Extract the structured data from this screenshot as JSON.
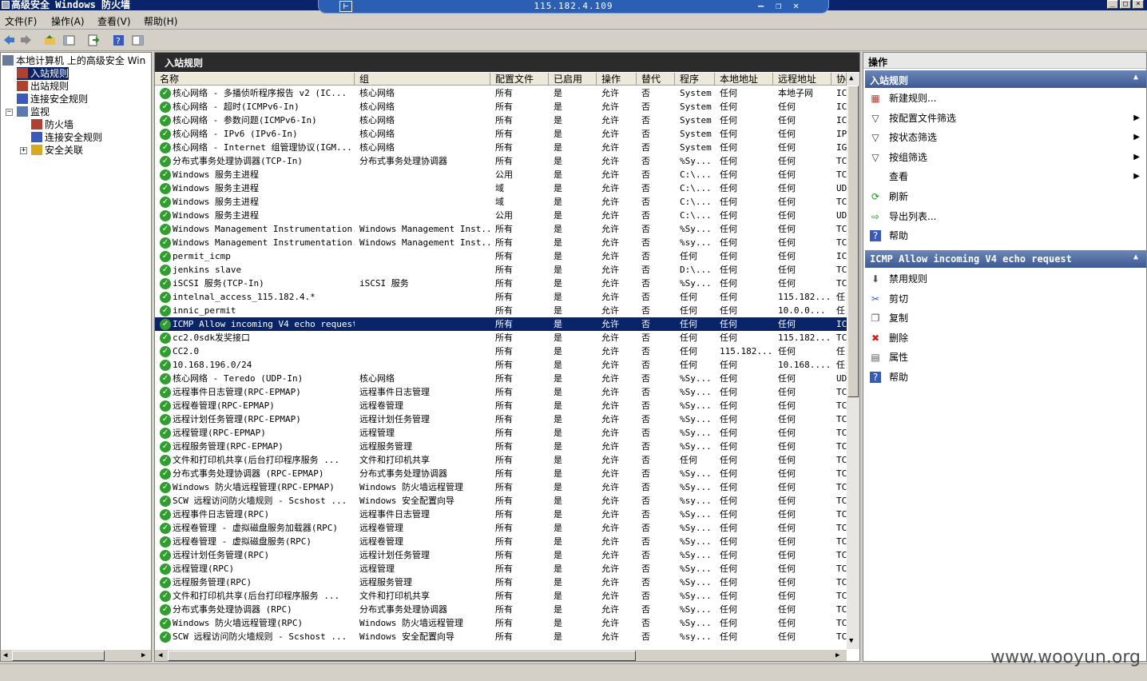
{
  "window": {
    "title": "高级安全 Windows 防火墙",
    "remote_ip": "115.182.4.109"
  },
  "menu": [
    "文件(F)",
    "操作(A)",
    "查看(V)",
    "帮助(H)"
  ],
  "tree": {
    "root": "本地计算机 上的高级安全 Win",
    "items": [
      "入站规则",
      "出站规则",
      "连接安全规则",
      "监视",
      "防火墙",
      "连接安全规则",
      "安全关联"
    ]
  },
  "center": {
    "title": "入站规则",
    "columns": [
      "名称",
      "组",
      "配置文件",
      "已启用",
      "操作",
      "替代",
      "程序",
      "本地地址",
      "远程地址",
      "协"
    ],
    "rows": [
      [
        "核心网络 - 多播侦听程序报告 v2 (IC...",
        "核心网络",
        "所有",
        "是",
        "允许",
        "否",
        "System",
        "任何",
        "本地子网",
        "IC"
      ],
      [
        "核心网络 - 超时(ICMPv6-In)",
        "核心网络",
        "所有",
        "是",
        "允许",
        "否",
        "System",
        "任何",
        "任何",
        "IC"
      ],
      [
        "核心网络 - 参数问题(ICMPv6-In)",
        "核心网络",
        "所有",
        "是",
        "允许",
        "否",
        "System",
        "任何",
        "任何",
        "IC"
      ],
      [
        "核心网络 - IPv6 (IPv6-In)",
        "核心网络",
        "所有",
        "是",
        "允许",
        "否",
        "System",
        "任何",
        "任何",
        "IP"
      ],
      [
        "核心网络 - Internet 组管理协议(IGM...",
        "核心网络",
        "所有",
        "是",
        "允许",
        "否",
        "System",
        "任何",
        "任何",
        "IG"
      ],
      [
        "分布式事务处理协调器(TCP-In)",
        "分布式事务处理协调器",
        "所有",
        "是",
        "允许",
        "否",
        "%Sy...",
        "任何",
        "任何",
        "TC"
      ],
      [
        "Windows 服务主进程",
        "",
        "公用",
        "是",
        "允许",
        "否",
        "C:\\...",
        "任何",
        "任何",
        "TC"
      ],
      [
        "Windows 服务主进程",
        "",
        "域",
        "是",
        "允许",
        "否",
        "C:\\...",
        "任何",
        "任何",
        "UD"
      ],
      [
        "Windows 服务主进程",
        "",
        "域",
        "是",
        "允许",
        "否",
        "C:\\...",
        "任何",
        "任何",
        "TC"
      ],
      [
        "Windows 服务主进程",
        "",
        "公用",
        "是",
        "允许",
        "否",
        "C:\\...",
        "任何",
        "任何",
        "UD"
      ],
      [
        "Windows Management Instrumentation...",
        "Windows Management Inst...",
        "所有",
        "是",
        "允许",
        "否",
        "%Sy...",
        "任何",
        "任何",
        "TC"
      ],
      [
        "Windows Management Instrumentation...",
        "Windows Management Inst...",
        "所有",
        "是",
        "允许",
        "否",
        "%sy...",
        "任何",
        "任何",
        "TC"
      ],
      [
        "permit_icmp",
        "",
        "所有",
        "是",
        "允许",
        "否",
        "任何",
        "任何",
        "任何",
        "IC"
      ],
      [
        "jenkins slave",
        "",
        "所有",
        "是",
        "允许",
        "否",
        "D:\\...",
        "任何",
        "任何",
        "TC"
      ],
      [
        "iSCSI 服务(TCP-In)",
        "iSCSI 服务",
        "所有",
        "是",
        "允许",
        "否",
        "%Sy...",
        "任何",
        "任何",
        "TC"
      ],
      [
        "intelnal_access_115.182.4.*",
        "",
        "所有",
        "是",
        "允许",
        "否",
        "任何",
        "任何",
        "115.182...",
        "任"
      ],
      [
        "innic_permit",
        "",
        "所有",
        "是",
        "允许",
        "否",
        "任何",
        "任何",
        "10.0.0...",
        "任"
      ],
      [
        "ICMP Allow incoming V4 echo request",
        "",
        "所有",
        "是",
        "允许",
        "否",
        "任何",
        "任何",
        "任何",
        "IC"
      ],
      [
        "cc2.0sdk发奖接口",
        "",
        "所有",
        "是",
        "允许",
        "否",
        "任何",
        "任何",
        "115.182...",
        "TC"
      ],
      [
        "CC2.0",
        "",
        "所有",
        "是",
        "允许",
        "否",
        "任何",
        "115.182...",
        "任何",
        "任"
      ],
      [
        "10.168.196.0/24",
        "",
        "所有",
        "是",
        "允许",
        "否",
        "任何",
        "任何",
        "10.168....",
        "任"
      ],
      [
        "核心网络 - Teredo (UDP-In)",
        "核心网络",
        "所有",
        "是",
        "允许",
        "否",
        "%Sy...",
        "任何",
        "任何",
        "UD"
      ],
      [
        "远程事件日志管理(RPC-EPMAP)",
        "远程事件日志管理",
        "所有",
        "是",
        "允许",
        "否",
        "%Sy...",
        "任何",
        "任何",
        "TC"
      ],
      [
        "远程卷管理(RPC-EPMAP)",
        "远程卷管理",
        "所有",
        "是",
        "允许",
        "否",
        "%Sy...",
        "任何",
        "任何",
        "TC"
      ],
      [
        "远程计划任务管理(RPC-EPMAP)",
        "远程计划任务管理",
        "所有",
        "是",
        "允许",
        "否",
        "%Sy...",
        "任何",
        "任何",
        "TC"
      ],
      [
        "远程管理(RPC-EPMAP)",
        "远程管理",
        "所有",
        "是",
        "允许",
        "否",
        "%Sy...",
        "任何",
        "任何",
        "TC"
      ],
      [
        "远程服务管理(RPC-EPMAP)",
        "远程服务管理",
        "所有",
        "是",
        "允许",
        "否",
        "%Sy...",
        "任何",
        "任何",
        "TC"
      ],
      [
        "文件和打印机共享(后台打印程序服务 ...",
        "文件和打印机共享",
        "所有",
        "是",
        "允许",
        "否",
        "任何",
        "任何",
        "任何",
        "TC"
      ],
      [
        "分布式事务处理协调器 (RPC-EPMAP)",
        "分布式事务处理协调器",
        "所有",
        "是",
        "允许",
        "否",
        "%Sy...",
        "任何",
        "任何",
        "TC"
      ],
      [
        "Windows 防火墙远程管理(RPC-EPMAP)",
        "Windows 防火墙远程管理",
        "所有",
        "是",
        "允许",
        "否",
        "%Sy...",
        "任何",
        "任何",
        "TC"
      ],
      [
        "SCW 远程访问防火墙规则 - Scshost ...",
        "Windows 安全配置向导",
        "所有",
        "是",
        "允许",
        "否",
        "%sy...",
        "任何",
        "任何",
        "TC"
      ],
      [
        "远程事件日志管理(RPC)",
        "远程事件日志管理",
        "所有",
        "是",
        "允许",
        "否",
        "%Sy...",
        "任何",
        "任何",
        "TC"
      ],
      [
        "远程卷管理 - 虚拟磁盘服务加载器(RPC)",
        "远程卷管理",
        "所有",
        "是",
        "允许",
        "否",
        "%Sy...",
        "任何",
        "任何",
        "TC"
      ],
      [
        "远程卷管理 - 虚拟磁盘服务(RPC)",
        "远程卷管理",
        "所有",
        "是",
        "允许",
        "否",
        "%Sy...",
        "任何",
        "任何",
        "TC"
      ],
      [
        "远程计划任务管理(RPC)",
        "远程计划任务管理",
        "所有",
        "是",
        "允许",
        "否",
        "%Sy...",
        "任何",
        "任何",
        "TC"
      ],
      [
        "远程管理(RPC)",
        "远程管理",
        "所有",
        "是",
        "允许",
        "否",
        "%Sy...",
        "任何",
        "任何",
        "TC"
      ],
      [
        "远程服务管理(RPC)",
        "远程服务管理",
        "所有",
        "是",
        "允许",
        "否",
        "%Sy...",
        "任何",
        "任何",
        "TC"
      ],
      [
        "文件和打印机共享(后台打印程序服务 ...",
        "文件和打印机共享",
        "所有",
        "是",
        "允许",
        "否",
        "%Sy...",
        "任何",
        "任何",
        "TC"
      ],
      [
        "分布式事务处理协调器 (RPC)",
        "分布式事务处理协调器",
        "所有",
        "是",
        "允许",
        "否",
        "%Sy...",
        "任何",
        "任何",
        "TC"
      ],
      [
        "Windows 防火墙远程管理(RPC)",
        "Windows 防火墙远程管理",
        "所有",
        "是",
        "允许",
        "否",
        "%Sy...",
        "任何",
        "任何",
        "TC"
      ],
      [
        "SCW 远程访问防火墙规则 - Scshost ...",
        "Windows 安全配置向导",
        "所有",
        "是",
        "允许",
        "否",
        "%sy...",
        "任何",
        "任何",
        "TC"
      ]
    ],
    "selected_row": 17
  },
  "actions": {
    "title": "操作",
    "section1": "入站规则",
    "items1": [
      {
        "label": "新建规则...",
        "icon": "new-rule-icon"
      },
      {
        "label": "按配置文件筛选",
        "icon": "filter-icon",
        "sub": true
      },
      {
        "label": "按状态筛选",
        "icon": "filter-icon",
        "sub": true
      },
      {
        "label": "按组筛选",
        "icon": "filter-icon",
        "sub": true
      },
      {
        "label": "查看",
        "icon": "",
        "sub": true
      },
      {
        "label": "刷新",
        "icon": "refresh-icon"
      },
      {
        "label": "导出列表...",
        "icon": "export-icon"
      },
      {
        "label": "帮助",
        "icon": "help-icon"
      }
    ],
    "section2": "ICMP Allow incoming V4 echo request",
    "items2": [
      {
        "label": "禁用规则",
        "icon": "disable-icon"
      },
      {
        "label": "剪切",
        "icon": "cut-icon"
      },
      {
        "label": "复制",
        "icon": "copy-icon"
      },
      {
        "label": "删除",
        "icon": "delete-icon"
      },
      {
        "label": "属性",
        "icon": "properties-icon"
      },
      {
        "label": "帮助",
        "icon": "help-icon"
      }
    ]
  },
  "watermark": "www.wooyun.org",
  "colors": {
    "titlebar": "#0a246a",
    "selected": "#0a246a",
    "enabled": "#2f9e2f",
    "section": "#4a64a0"
  }
}
